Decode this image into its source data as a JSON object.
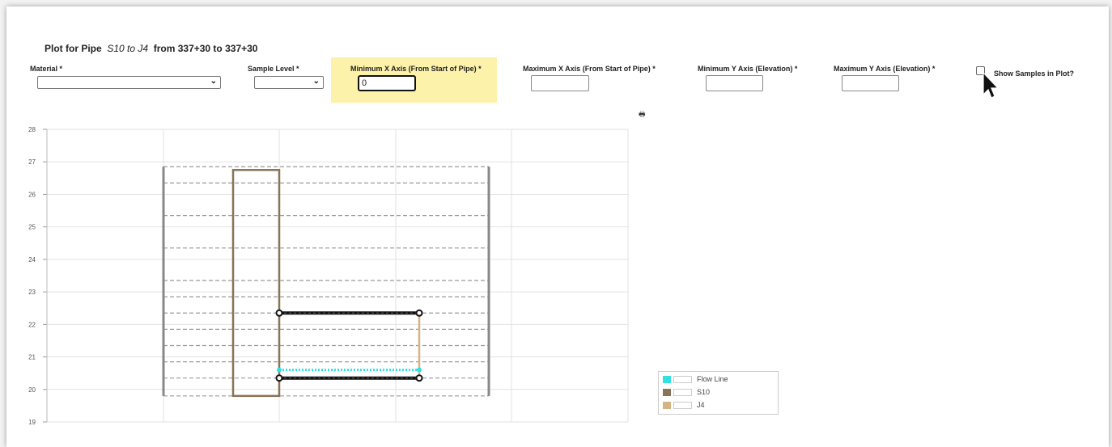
{
  "header": {
    "prefix": "Plot for Pipe",
    "pipe_name": "S10 to J4",
    "range": "from 337+30 to 337+30"
  },
  "fields": {
    "material": {
      "label": "Material *",
      "value": ""
    },
    "sample_level": {
      "label": "Sample Level *",
      "value": ""
    },
    "min_x": {
      "label": "Minimum X Axis (From Start of Pipe) *",
      "value": "0"
    },
    "max_x": {
      "label": "Maximum X Axis (From Start of Pipe) *",
      "value": ""
    },
    "min_y": {
      "label": "Minimum Y Axis (Elevation) *",
      "value": ""
    },
    "max_y": {
      "label": "Maximum Y Axis (Elevation) *",
      "value": ""
    },
    "show_samples": {
      "label": "Show Samples in Plot?",
      "checked": false
    }
  },
  "icons": {
    "print": "print-icon",
    "cursor": "mouse-pointer-icon",
    "dropdown": "chevron-down-icon"
  },
  "chart_data": {
    "type": "line",
    "ylim": [
      19,
      28
    ],
    "yticks": [
      "19",
      "20",
      "21",
      "22",
      "23",
      "24",
      "25",
      "26",
      "27",
      "28"
    ],
    "grid": true,
    "legend_position": "bottom-right",
    "series": [
      {
        "name": "Flow Line",
        "color": "#33e0e0"
      },
      {
        "name": "S10",
        "color": "#8a7356"
      },
      {
        "name": "J4",
        "color": "#d4b487"
      }
    ],
    "structures": {
      "S10": {
        "bottom": 19.8,
        "top": 26.75
      },
      "J4": {
        "bottom": 20.35,
        "top": 22.35
      }
    },
    "pipe": {
      "crown": 22.35,
      "invert": 20.35,
      "flow_line": 20.6
    },
    "dashed_levels": [
      19.8,
      20.35,
      20.85,
      21.35,
      21.85,
      22.35,
      22.85,
      23.35,
      24.35,
      25.35,
      26.35,
      26.85
    ]
  }
}
